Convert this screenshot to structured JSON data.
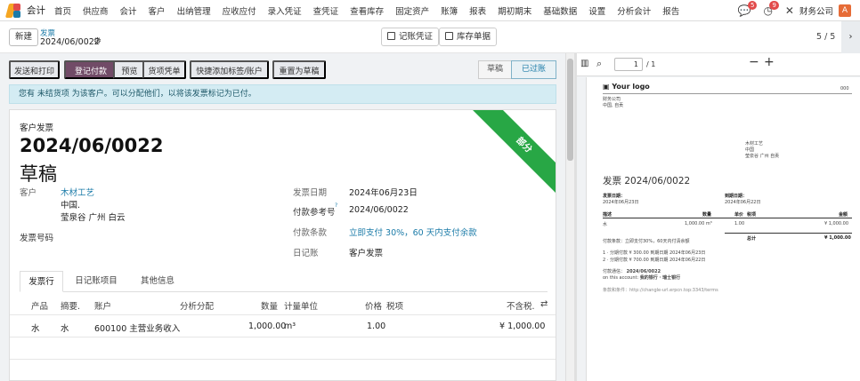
{
  "nav": {
    "app_name": "会计",
    "items": [
      "首页",
      "供应商",
      "会计",
      "客户",
      "出纳管理",
      "应收应付",
      "录入凭证",
      "查凭证",
      "查看库存",
      "固定资产",
      "账簿",
      "报表",
      "期初期末",
      "基础数据",
      "设置",
      "分析会计",
      "报告"
    ],
    "chat_badge": "5",
    "activity_badge": "9",
    "company": "财务公司",
    "avatar_letter": "A",
    "colors": {
      "logo_a": "#f5a623",
      "logo_b": "#e24b4b",
      "logo_c": "#1b7ba8"
    }
  },
  "control": {
    "new_label": "新建",
    "breadcrumb_parent": "发票",
    "breadcrumb_current": "2024/06/0022",
    "smart_journal": "记账凭证",
    "smart_stock": "库存单据",
    "pager": "5 / 5"
  },
  "actions": {
    "send_print": "发送和打印",
    "register_payment": "登记付款",
    "preview": "预览",
    "goods_voucher": "货项凭单",
    "quick_tag": "快捷添加标签/账户",
    "reset_draft": "重置为草稿",
    "stages": [
      "草稿",
      "已过账"
    ],
    "colors": {
      "primary": "#714b67",
      "ribbon": "#28a745"
    }
  },
  "alert": {
    "text": "您有 未结货项 为该客户。可以分配他们，以将该发票标记为已付。"
  },
  "form": {
    "doc_type": "客户发票",
    "number": "2024/06/0022",
    "state": "草稿",
    "ribbon": "部分",
    "customer_label": "客户",
    "customer_name": "木材工艺",
    "customer_addr1": "中国.",
    "customer_addr2": "莹泉谷 广州 白云",
    "invoice_no_label": "发票号码",
    "date_label": "发票日期",
    "date_value": "2024年06月23日",
    "ref_label": "付款参考号",
    "ref_help": "?",
    "ref_value": "2024/06/0022",
    "terms_label": "付款条款",
    "terms_value": "立即支付 30%，60 天内支付余款",
    "journal_label": "日记账",
    "journal_value": "客户发票"
  },
  "tabs": [
    "发票行",
    "日记账项目",
    "其他信息"
  ],
  "lines": {
    "headers": [
      "产品",
      "摘要.",
      "账户",
      "分析分配",
      "数量",
      "计量单位",
      "价格",
      "税项",
      "不含税."
    ],
    "rows": [
      {
        "product": "水",
        "label": "水",
        "account": "600100 主营业务收入",
        "quantity": "1,000.00",
        "uom": "m³",
        "price": "1.00",
        "subtotal": "¥ 1,000.00"
      }
    ]
  },
  "pdf": {
    "page_input": "1",
    "page_total": "/ 1",
    "logo": "Your logo",
    "logo_right": "000",
    "company_line1": "财务公司",
    "company_line2": "中国, 自贡",
    "partner_line1": "木材工艺",
    "partner_line2": "中国",
    "partner_line3": "莹泉谷 广州 自贡",
    "title": "发票 2024/06/0022",
    "inv_date_label": "发票日期：",
    "inv_date": "2024年06月23日",
    "due_label": "到期日期：",
    "due_date": "2024年06月22日",
    "col_desc": "描述",
    "col_qty": "数量",
    "col_price": "单价",
    "col_tax": "税项",
    "col_amount": "金额",
    "row_desc": "水",
    "row_qty": "1,000.00 m³",
    "row_price": "1.00",
    "row_amount": "¥ 1,000.00",
    "total_label": "总计",
    "total_value": "¥ 1,000.00",
    "terms": "付款条款：立即支付30%，60天内付清余额",
    "inst1": "1 · 分期付款 ¥ 300.00 到期日期 2024年06月23日",
    "inst2": "2 · 分期付款 ¥ 700.00 到期日期 2024年06月22日",
    "comm_label": "付款通信：",
    "comm_value": "2024/06/0022",
    "bank_prefix": "on this account:",
    "bank": "我的银行 · 瑞士银行",
    "terms_url": "条款和条件：http://changle-url.erpcn.top:3343/terms"
  }
}
